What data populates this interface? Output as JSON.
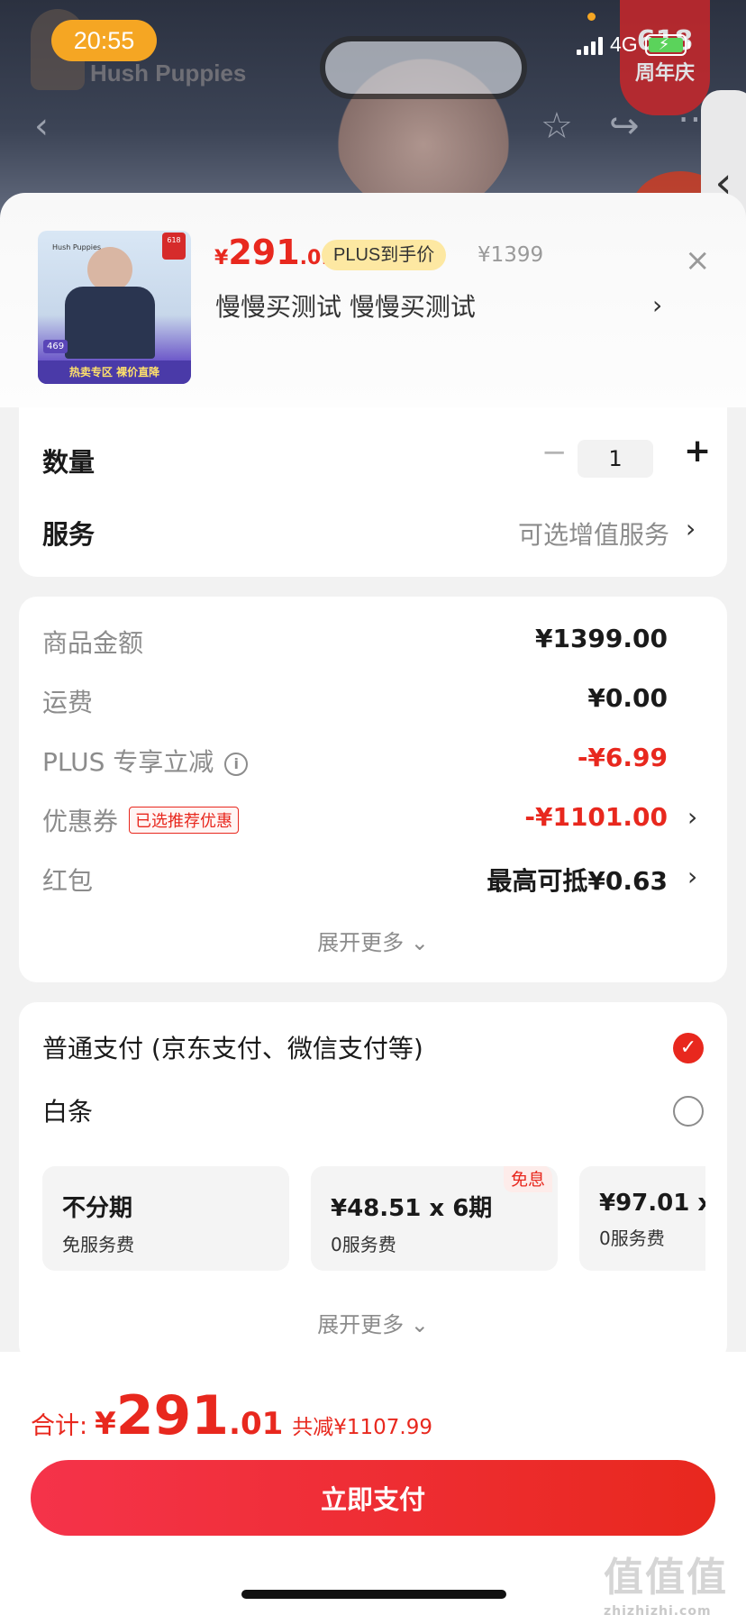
{
  "status_bar": {
    "time": "20:55",
    "network": "4G"
  },
  "background": {
    "brand_logo": "Hush Puppies",
    "promo_badge_line1": "618",
    "promo_badge_line2": "周年庆"
  },
  "nav_icons": [
    "back-icon",
    "star-icon",
    "share-icon",
    "more-icon"
  ],
  "product": {
    "thumb_brand": "Hush Puppies",
    "thumb_badge": "618",
    "thumb_price": "469",
    "thumb_banner": "热卖专区 裸价直降",
    "price_symbol": "¥",
    "price_int": "291",
    "price_dec": ".01",
    "plus_badge": "PLUS到手价",
    "original_price": "¥1399",
    "variant": "慢慢买测试  慢慢买测试",
    "close": "×",
    "chevron": "›"
  },
  "quantity": {
    "label": "数量",
    "minus": "−",
    "value": "1",
    "plus": "+"
  },
  "service": {
    "label": "服务",
    "value": "可选增值服务",
    "chevron": "›"
  },
  "fees": {
    "items": [
      {
        "label": "商品金额",
        "value": "¥1399.00"
      },
      {
        "label": "运费",
        "value": "¥0.00"
      },
      {
        "label": "PLUS 专享立减",
        "value": "-¥6.99"
      },
      {
        "label": "优惠券",
        "tag": "已选推荐优惠",
        "value": "-¥1101.00"
      },
      {
        "label": "红包",
        "value": "最高可抵¥0.63"
      }
    ],
    "expand": "展开更多 ⌄"
  },
  "payment": {
    "normal": "普通支付 (京东支付、微信支付等)",
    "baitiao": "白条",
    "installments": [
      {
        "title": "不分期",
        "sub": "免服务费",
        "tag": ""
      },
      {
        "title": "¥48.51 x 6期",
        "sub": "0服务费",
        "tag": "免息"
      },
      {
        "title": "¥97.01 x",
        "sub": "0服务费",
        "tag": ""
      }
    ],
    "expand": "展开更多 ⌄"
  },
  "footer": {
    "total_label": "合计:",
    "total_symbol": "¥",
    "total_int": "291",
    "total_dec": ".01",
    "savings": "共减¥1107.99",
    "pay_button": "立即支付"
  },
  "watermark": {
    "main": "值值值",
    "sub": "zhizhizhi.com"
  },
  "colors": {
    "accent": "#e8281e",
    "plus_badge": "#fde8a2",
    "time_pill": "#f5a623"
  }
}
